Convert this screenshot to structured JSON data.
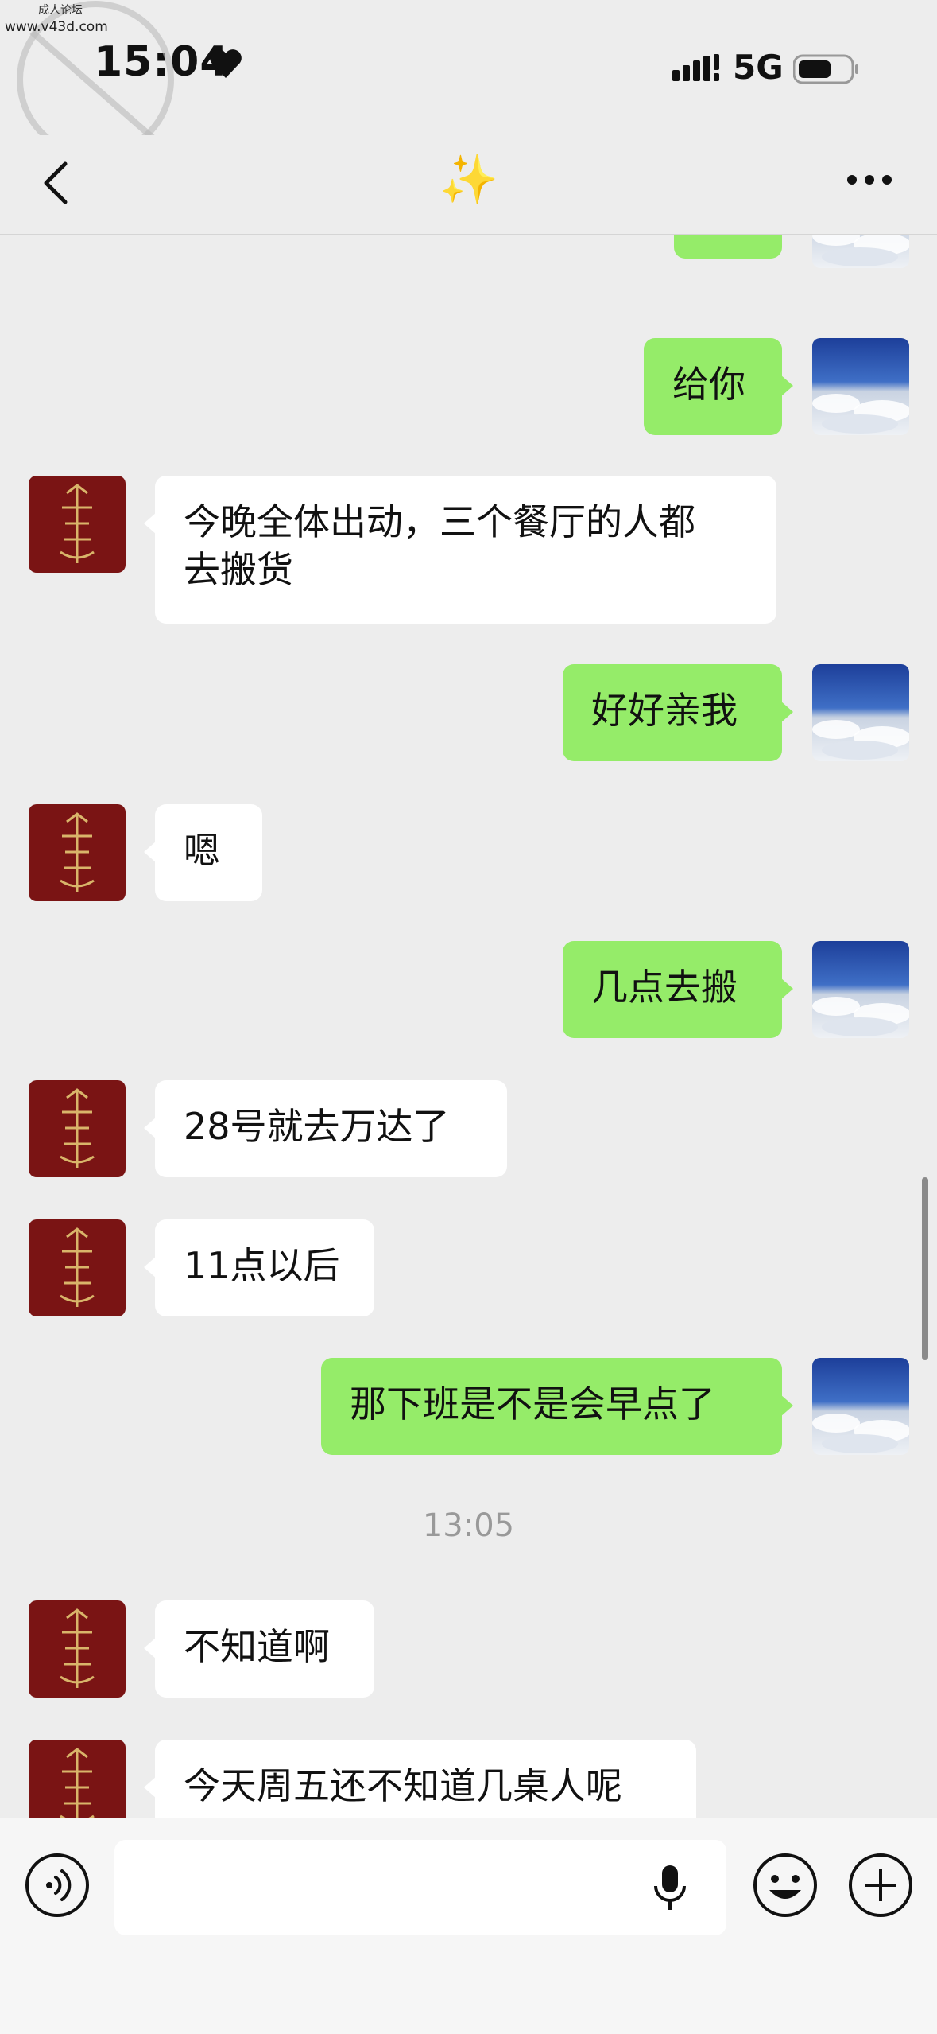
{
  "status_bar": {
    "time": "15:04",
    "network": "5G"
  },
  "watermark": {
    "line1": "成人论坛",
    "url": "www.v43d.com"
  },
  "nav": {
    "title": "✨"
  },
  "messages": [
    {
      "side": "out",
      "text": "👄"
    },
    {
      "side": "out",
      "text": "给你"
    },
    {
      "side": "in",
      "text": "今晚全体出动，三个餐厅的人都\n去搬货"
    },
    {
      "side": "out",
      "text": "好好亲我"
    },
    {
      "side": "in",
      "text": "嗯"
    },
    {
      "side": "out",
      "text": "几点去搬"
    },
    {
      "side": "in",
      "text": "28号就去万达了"
    },
    {
      "side": "in",
      "text": "11点以后"
    },
    {
      "side": "out",
      "text": "那下班是不是会早点了"
    },
    {
      "side": "in",
      "text": "不知道啊"
    },
    {
      "side": "in",
      "text": "今天周五还不知道几桌人呢"
    }
  ],
  "timestamp": "13:05",
  "input": {
    "placeholder": ""
  },
  "colors": {
    "background": "#ededed",
    "bubble_out": "#95ec69",
    "bubble_in": "#ffffff",
    "avatar_bg": "#7a1414"
  },
  "icons": [
    "back-icon",
    "more-icon",
    "voice-icon",
    "mic-icon",
    "emoji-icon",
    "plus-icon",
    "heart-icon",
    "signal-icon",
    "battery-icon"
  ]
}
